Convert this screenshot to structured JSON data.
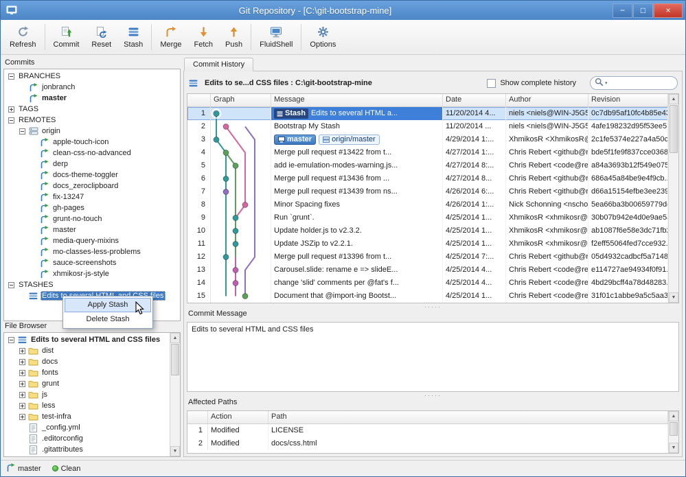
{
  "window": {
    "title": "Git Repository - [C:\\git-bootstrap-mine]",
    "controls": {
      "minimize": "−",
      "maximize": "□",
      "close": "×"
    }
  },
  "toolbar": {
    "items": [
      {
        "id": "refresh",
        "label": "Refresh",
        "sep": true
      },
      {
        "id": "commit",
        "label": "Commit"
      },
      {
        "id": "reset",
        "label": "Reset"
      },
      {
        "id": "stash",
        "label": "Stash",
        "sep": true
      },
      {
        "id": "merge",
        "label": "Merge"
      },
      {
        "id": "fetch",
        "label": "Fetch"
      },
      {
        "id": "push",
        "label": "Push",
        "sep": true
      },
      {
        "id": "fluidshell",
        "label": "FluidShell",
        "sep": true
      },
      {
        "id": "options",
        "label": "Options"
      }
    ]
  },
  "commits_panel": {
    "title": "Commits",
    "tree": [
      {
        "depth": 0,
        "expander": "minus",
        "label": "BRANCHES"
      },
      {
        "depth": 1,
        "icon": "branch",
        "label": "jonbranch"
      },
      {
        "depth": 1,
        "icon": "branch",
        "label": "master",
        "bold": true
      },
      {
        "depth": 0,
        "expander": "plus",
        "label": "TAGS"
      },
      {
        "depth": 0,
        "expander": "minus",
        "label": "REMOTES"
      },
      {
        "depth": 1,
        "expander": "minus",
        "icon": "remote",
        "label": "origin"
      },
      {
        "depth": 2,
        "icon": "branch",
        "label": "apple-touch-icon"
      },
      {
        "depth": 2,
        "icon": "branch",
        "label": "clean-css-no-advanced"
      },
      {
        "depth": 2,
        "icon": "branch",
        "label": "derp"
      },
      {
        "depth": 2,
        "icon": "branch",
        "label": "docs-theme-toggler"
      },
      {
        "depth": 2,
        "icon": "branch",
        "label": "docs_zeroclipboard"
      },
      {
        "depth": 2,
        "icon": "branch",
        "label": "fix-13247"
      },
      {
        "depth": 2,
        "icon": "branch",
        "label": "gh-pages"
      },
      {
        "depth": 2,
        "icon": "branch",
        "label": "grunt-no-touch"
      },
      {
        "depth": 2,
        "icon": "branch",
        "label": "master"
      },
      {
        "depth": 2,
        "icon": "branch",
        "label": "media-query-mixins"
      },
      {
        "depth": 2,
        "icon": "branch",
        "label": "mo-classes-less-problems"
      },
      {
        "depth": 2,
        "icon": "branch",
        "label": "sauce-screenshots"
      },
      {
        "depth": 2,
        "icon": "branch",
        "label": "xhmikosr-js-style"
      },
      {
        "depth": 0,
        "expander": "minus",
        "label": "STASHES"
      },
      {
        "depth": 1,
        "icon": "stash-item",
        "label": "Edits to several HTML and CSS files",
        "selected": true
      }
    ]
  },
  "context_menu": {
    "items": [
      {
        "label": "Apply Stash"
      },
      {
        "label": "Delete Stash"
      }
    ]
  },
  "file_browser": {
    "title": "File Browser",
    "tree": [
      {
        "depth": 0,
        "expander": "minus",
        "icon": "stash-item",
        "label": "Edits to several HTML and CSS files",
        "bold": true
      },
      {
        "depth": 1,
        "expander": "plus",
        "icon": "folder",
        "label": "dist"
      },
      {
        "depth": 1,
        "expander": "plus",
        "icon": "folder",
        "label": "docs"
      },
      {
        "depth": 1,
        "expander": "plus",
        "icon": "folder",
        "label": "fonts"
      },
      {
        "depth": 1,
        "expander": "plus",
        "icon": "folder",
        "label": "grunt"
      },
      {
        "depth": 1,
        "expander": "plus",
        "icon": "folder",
        "label": "js"
      },
      {
        "depth": 1,
        "expander": "plus",
        "icon": "folder",
        "label": "less"
      },
      {
        "depth": 1,
        "expander": "plus",
        "icon": "folder",
        "label": "test-infra"
      },
      {
        "depth": 1,
        "icon": "file",
        "label": "_config.yml"
      },
      {
        "depth": 1,
        "icon": "file",
        "label": ".editorconfig"
      },
      {
        "depth": 1,
        "icon": "file",
        "label": ".gitattributes"
      }
    ]
  },
  "history": {
    "tab": "Commit History",
    "info": "Edits to se...d CSS files : C:\\git-bootstrap-mine",
    "show_complete_history": "Show complete history",
    "checkbox_checked": false,
    "search_value": "",
    "columns": [
      "",
      "Graph",
      "Message",
      "Date",
      "Author",
      "Revision"
    ],
    "rows": [
      {
        "num": 1,
        "selected": true,
        "stash_badge": "Stash",
        "message": "Edits to several HTML a...",
        "date": "11/20/2014 4...",
        "author": "niels <niels@WIN-J5G5...",
        "revision": "0c7db95af10fc4b85e43...",
        "graph": {
          "col": 0,
          "color": "#2f9a9a"
        }
      },
      {
        "num": 2,
        "message": "Bootstrap My Stash",
        "date": "11/20/2014 ...",
        "author": "niels <niels@WIN-J5G5...",
        "revision": "4afe198232d95f53ee5...",
        "graph": {
          "col": 1,
          "color": "#d4679f"
        }
      },
      {
        "num": 3,
        "message": "",
        "badges": [
          {
            "label": "master",
            "style": "solid"
          },
          {
            "label": "origin/master",
            "style": "outline"
          }
        ],
        "date": "4/29/2014 1:...",
        "author": "XhmikosR <XhmikosR@...",
        "revision": "2c1fe5374e227a4a50cc...",
        "graph": {
          "col": 0,
          "color": "#2f9a9a"
        }
      },
      {
        "num": 4,
        "message": "Merge pull request #13422 from t...",
        "date": "4/27/2014 1:...",
        "author": "Chris Rebert <github@r...",
        "revision": "bde5f1fe9f837cce0368...",
        "graph": {
          "col": 1,
          "color": "#5ba05b"
        }
      },
      {
        "num": 5,
        "message": "add ie-emulation-modes-warning.js...",
        "date": "4/27/2014 8:...",
        "author": "Chris Rebert <code@re...",
        "revision": "a84a3693b12f549e075...",
        "graph": {
          "col": 2,
          "color": "#5ba05b"
        }
      },
      {
        "num": 6,
        "message": "Merge pull request #13436 from ...",
        "date": "4/27/2014 8...",
        "author": "Chris Rebert <github@r...",
        "revision": "686a45a84be9e4f9cb...",
        "graph": {
          "col": 1,
          "color": "#2f9a9a"
        }
      },
      {
        "num": 7,
        "message": "Merge pull request #13439 from ns...",
        "date": "4/26/2014 6:...",
        "author": "Chris Rebert <github@r...",
        "revision": "d66a15154efbe3ee239...",
        "graph": {
          "col": 1,
          "color": "#8f6fc0"
        }
      },
      {
        "num": 8,
        "message": "Minor Spacing fixes",
        "date": "4/26/2014 1:...",
        "author": "Nick Schonning <nschon...",
        "revision": "5ea66ba3b00659779dc...",
        "graph": {
          "col": 3,
          "color": "#d4679f"
        }
      },
      {
        "num": 9,
        "message": "Run `grunt`.",
        "date": "4/25/2014 1...",
        "author": "XhmikosR <xhmikosr@u...",
        "revision": "30b07b942e4d0e9ae5a...",
        "graph": {
          "col": 2,
          "color": "#2f9a9a"
        }
      },
      {
        "num": 10,
        "message": "Update holder.js to v2.3.2.",
        "date": "4/25/2014 1...",
        "author": "XhmikosR <xhmikosr@u...",
        "revision": "ab1087f6e58e3dc71fb2...",
        "graph": {
          "col": 2,
          "color": "#2f9a9a"
        }
      },
      {
        "num": 11,
        "message": "Update JSZip to v2.2.1.",
        "date": "4/25/2014 1...",
        "author": "XhmikosR <xhmikosr@u...",
        "revision": "f2eff55064fed7cce932...",
        "graph": {
          "col": 2,
          "color": "#2f9a9a"
        }
      },
      {
        "num": 12,
        "message": "Merge pull request #13396 from t...",
        "date": "4/25/2014 7:...",
        "author": "Chris Rebert <github@r...",
        "revision": "05d4932cadbcf5a7148...",
        "graph": {
          "col": 1,
          "color": "#2f9a9a"
        }
      },
      {
        "num": 13,
        "message": "Carousel.slide: rename e => slideE...",
        "date": "4/25/2014 4...",
        "author": "Chris Rebert <code@re...",
        "revision": "e114727ae94934f0f91...",
        "graph": {
          "col": 2,
          "color": "#c05fb0"
        }
      },
      {
        "num": 14,
        "message": "change 'slid' comments per @fat's f...",
        "date": "4/25/2014 4...",
        "author": "Chris Rebert <code@re...",
        "revision": "4bd29bcff4a78d48283...",
        "graph": {
          "col": 2,
          "color": "#c05fb0"
        }
      },
      {
        "num": 15,
        "message": "Document that @import-ing Bootst...",
        "date": "4/25/2014 1...",
        "author": "Chris Rebert <code@re...",
        "revision": "31f01c1abbe9a5c5aa3...",
        "graph": {
          "col": 3,
          "color": "#5ba05b"
        }
      }
    ],
    "graph": {
      "lines": [
        {
          "color": "#2f9a9a",
          "points": [
            [
              0,
              1
            ],
            [
              0,
              3
            ],
            [
              1,
              4
            ],
            [
              1,
              12
            ],
            [
              1,
              15
            ]
          ]
        },
        {
          "color": "#d4679f",
          "points": [
            [
              1,
              2
            ],
            [
              2,
              3
            ],
            [
              3,
              4
            ],
            [
              3,
              8
            ],
            [
              2,
              9
            ],
            [
              2,
              12
            ]
          ]
        },
        {
          "color": "#5ba05b",
          "points": [
            [
              1,
              4
            ],
            [
              2,
              5
            ],
            [
              2,
              8
            ],
            [
              2,
              12
            ],
            [
              2,
              15
            ]
          ]
        },
        {
          "color": "#8f6fc0",
          "points": [
            [
              3,
              2
            ],
            [
              4,
              3
            ],
            [
              4,
              12
            ],
            [
              3,
              13
            ],
            [
              3,
              15
            ]
          ]
        },
        {
          "color": "#c05fb0",
          "points": [
            [
              2,
              12
            ],
            [
              2,
              15
            ]
          ]
        }
      ]
    }
  },
  "commit_message": {
    "title": "Commit Message",
    "text": "Edits to several HTML and CSS files"
  },
  "affected_paths": {
    "title": "Affected Paths",
    "columns": [
      "",
      "Action",
      "Path"
    ],
    "rows": [
      {
        "num": 1,
        "action": "Modified",
        "path": "LICENSE"
      },
      {
        "num": 2,
        "action": "Modified",
        "path": "docs/css.html"
      }
    ]
  },
  "statusbar": {
    "branch": "master",
    "state": "Clean"
  },
  "ui": {
    "splitter_dots": "·····",
    "search_caret": "▾",
    "scroll_up": "▲",
    "scroll_down": "▼"
  }
}
